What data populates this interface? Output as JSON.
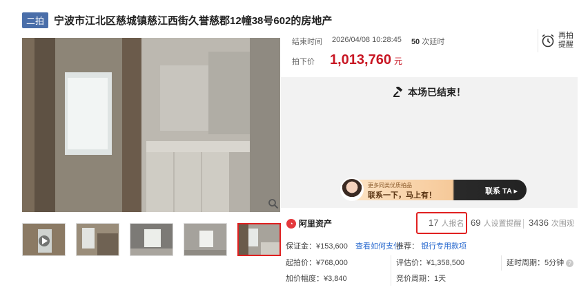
{
  "header": {
    "badge": "二拍",
    "title": "宁波市江北区慈城镇慈江西街久誉慈郡12幢38号602的房地产"
  },
  "auction": {
    "end_label": "结束时间",
    "end_time": "2026/04/08 10:28:45",
    "delay_count": "50",
    "delay_label": "次延时",
    "remind_label": "再拍提醒",
    "final_price_label": "拍下价",
    "final_price": "1,013,760",
    "price_unit": "元",
    "ended_text": "本场已结束！"
  },
  "banner": {
    "sub": "更多同类优质拍品",
    "main": "联系一下，马上有！",
    "cta": "联系 TA ▸"
  },
  "stats": {
    "brand": "阿里资产",
    "signups": "17",
    "signups_label": "人报名",
    "reminders": "69",
    "reminders_label": "人设置提醒",
    "views": "3436",
    "views_label": "次围观"
  },
  "details": {
    "deposit": "保证金：¥153,600",
    "deposit_link": "查看如何支付",
    "recommend_label": "推荐：",
    "recommend_link": "银行专用款项",
    "start_price": "起拍价：¥768,000",
    "appraisal": "评估价：¥1,358,500",
    "delay_period": "延时周期：5分钟",
    "increment": "加价幅度：¥3,840",
    "bid_period": "竞价周期：1天"
  },
  "colors": {
    "accent_red": "#c81623",
    "badge_blue": "#4a6ea9",
    "link_blue": "#2a6acf"
  }
}
